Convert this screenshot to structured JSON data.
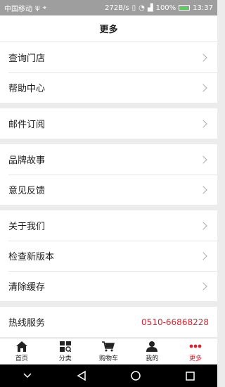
{
  "status": {
    "carrier": "中国移动",
    "speed": "272B/s",
    "battery": "100%",
    "time": "13:37"
  },
  "header": {
    "title": "更多"
  },
  "menu": {
    "store_query": "查询门店",
    "help_center": "帮助中心",
    "mail_subscribe": "邮件订阅",
    "brand_story": "品牌故事",
    "feedback": "意见反馈",
    "about_us": "关于我们",
    "check_version": "检查新版本",
    "clear_cache": "清除缓存",
    "hotline_label": "热线服务",
    "hotline_number": "0510-66868228"
  },
  "tabs": {
    "home": "首页",
    "category": "分类",
    "cart": "购物车",
    "mine": "我的",
    "more": "更多"
  },
  "colors": {
    "accent": "#d9232e",
    "background": "#ececec"
  }
}
